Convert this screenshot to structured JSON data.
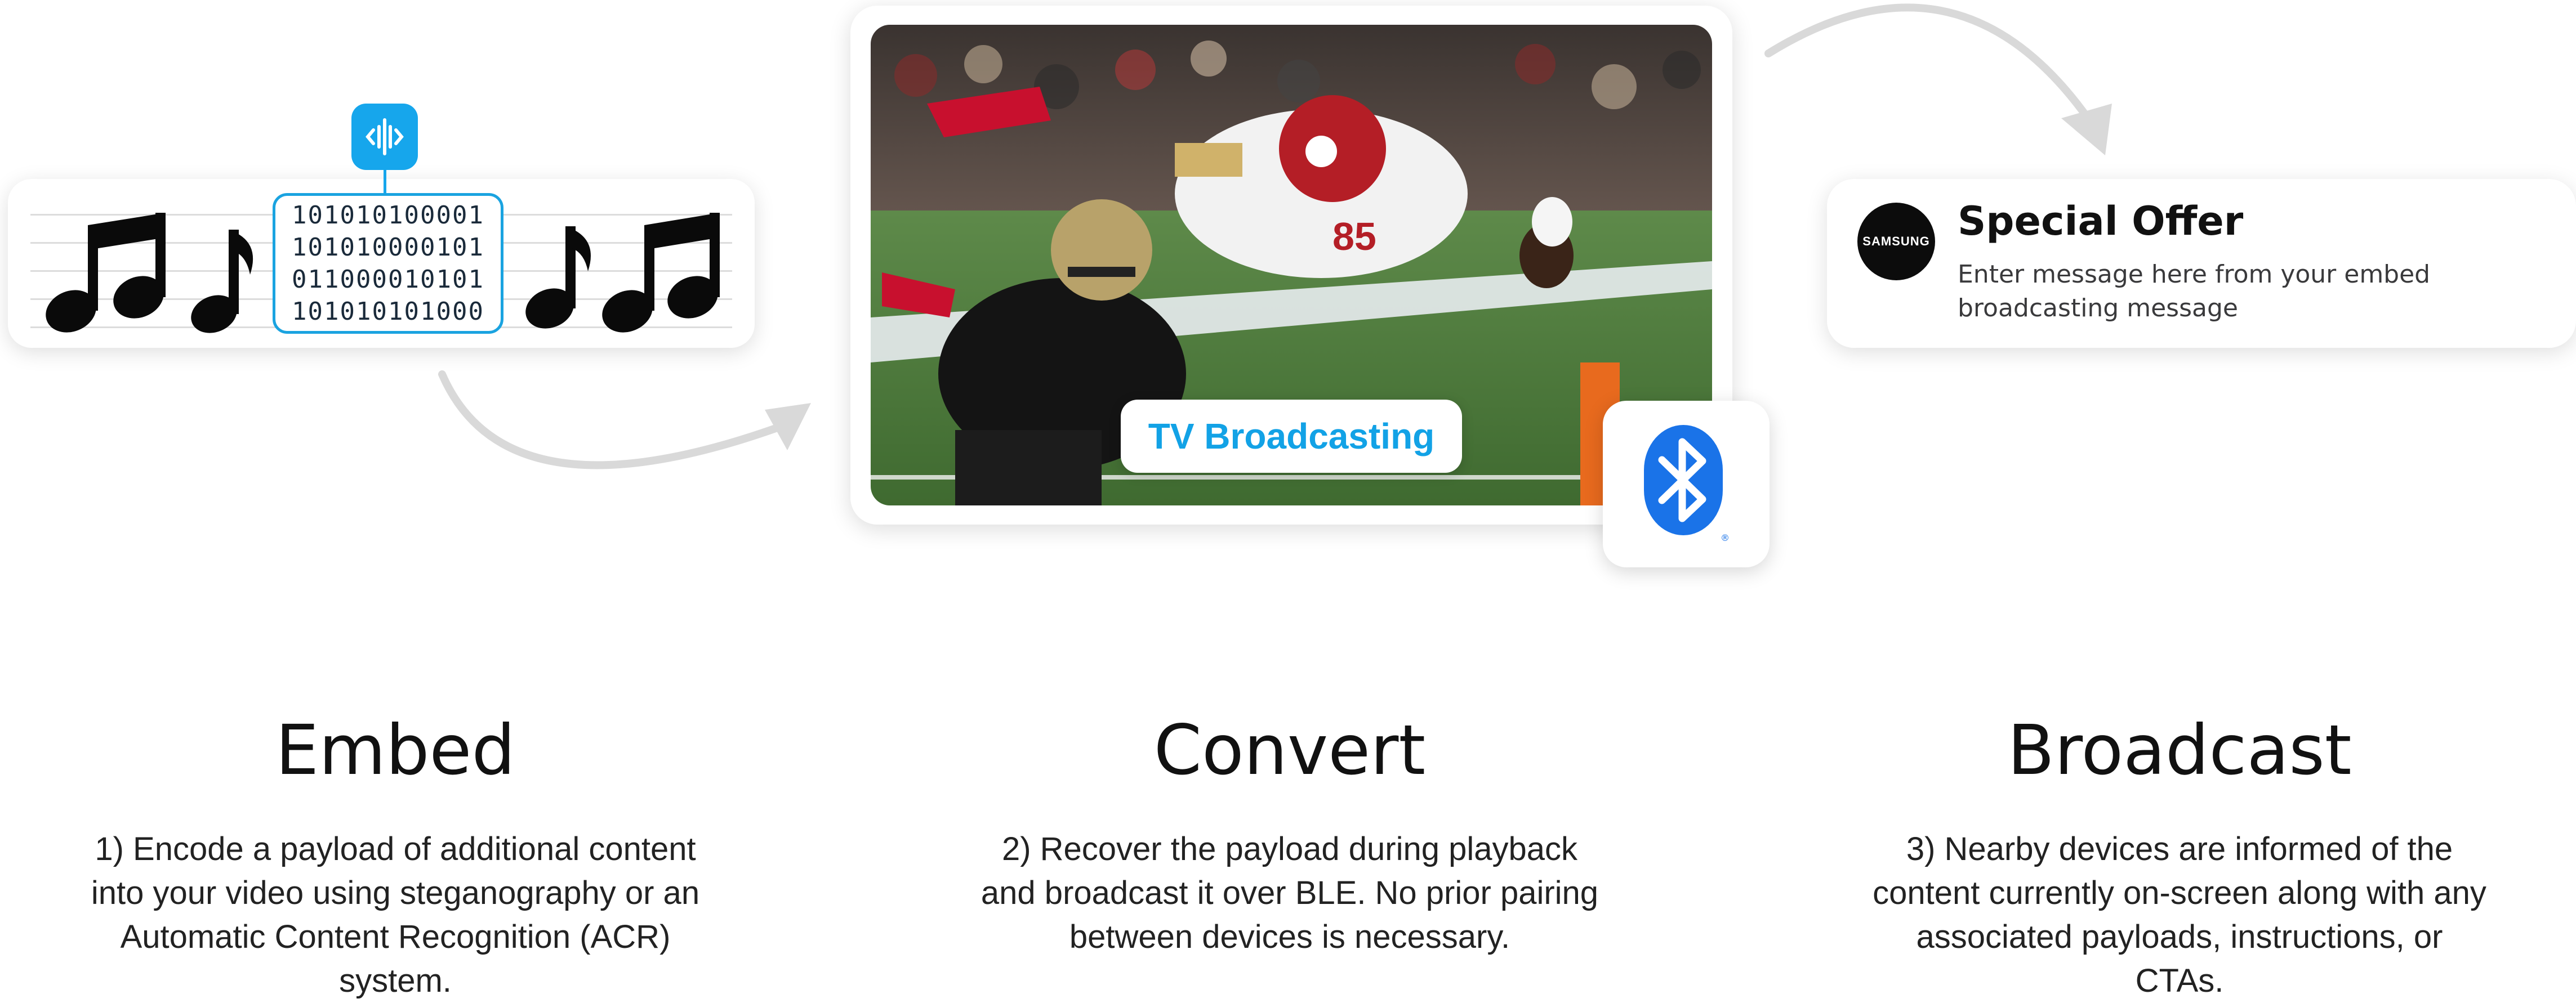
{
  "embed": {
    "code_lines": [
      "101010100001",
      "101010000101",
      "011000010101",
      "101010101000"
    ],
    "icon": "sound-wave-icon",
    "accent": "#16a6ec"
  },
  "video": {
    "label": "TV Broadcasting",
    "jersey_number": "85",
    "icon": "bluetooth-icon",
    "bluetooth_color": "#1a73e8"
  },
  "notification": {
    "brand": "SAMSUNG",
    "title": "Special Offer",
    "body": "Enter message here from your embed broadcasting message"
  },
  "steps": [
    {
      "title": "Embed",
      "description": "1) Encode a payload of additional content into your video using steganography or an Automatic Content Recognition (ACR) system."
    },
    {
      "title": "Convert",
      "description": "2) Recover the payload during playback and broadcast it over BLE. No prior pairing between devices is necessary."
    },
    {
      "title": "Broadcast",
      "description": "3) Nearby devices are informed of the content currently on-screen along with any associated payloads, instructions, or CTAs."
    }
  ]
}
